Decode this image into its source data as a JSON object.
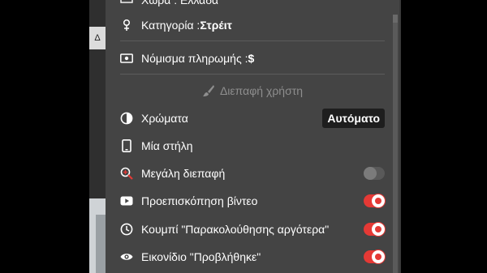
{
  "background": {
    "tab_letter": "Δ"
  },
  "menu": {
    "top_partial_row": {
      "icon": "flag-icon",
      "label": "Χώρα : Ελλάδα"
    },
    "category": {
      "icon": "person-icon",
      "label": "Κατηγορία : ",
      "value": "Στρέιτ"
    },
    "currency": {
      "icon": "banknote-icon",
      "label": "Νόμισμα πληρωμής : ",
      "value": "$"
    },
    "section_title": {
      "icon": "brush-icon",
      "label": "Διεπαφή χρήστη"
    },
    "items": [
      {
        "icon": "contrast-icon",
        "label": "Χρώματα",
        "control": "pill",
        "control_value": "Αυτόματο"
      },
      {
        "icon": "phone-icon",
        "label": "Μία στήλη",
        "control": "none"
      },
      {
        "icon": "zoom-icon",
        "label": "Μεγάλη διεπαφή",
        "control": "toggle",
        "on": false
      },
      {
        "icon": "play-icon",
        "label": "Προεπισκόπηση βίντεο",
        "control": "toggle",
        "on": true
      },
      {
        "icon": "clock-icon",
        "label": "Κουμπί \"Παρακολούθησης αργότερα\"",
        "control": "toggle",
        "on": true
      },
      {
        "icon": "eye-icon",
        "label": "Εικονίδιο \"Προβλήθηκε\"",
        "control": "toggle",
        "on": true
      }
    ]
  },
  "colors": {
    "menu_bg": "#444444",
    "toggle_on": "#e53935",
    "toggle_off": "#595959",
    "section_title": "#8e8e8e"
  }
}
